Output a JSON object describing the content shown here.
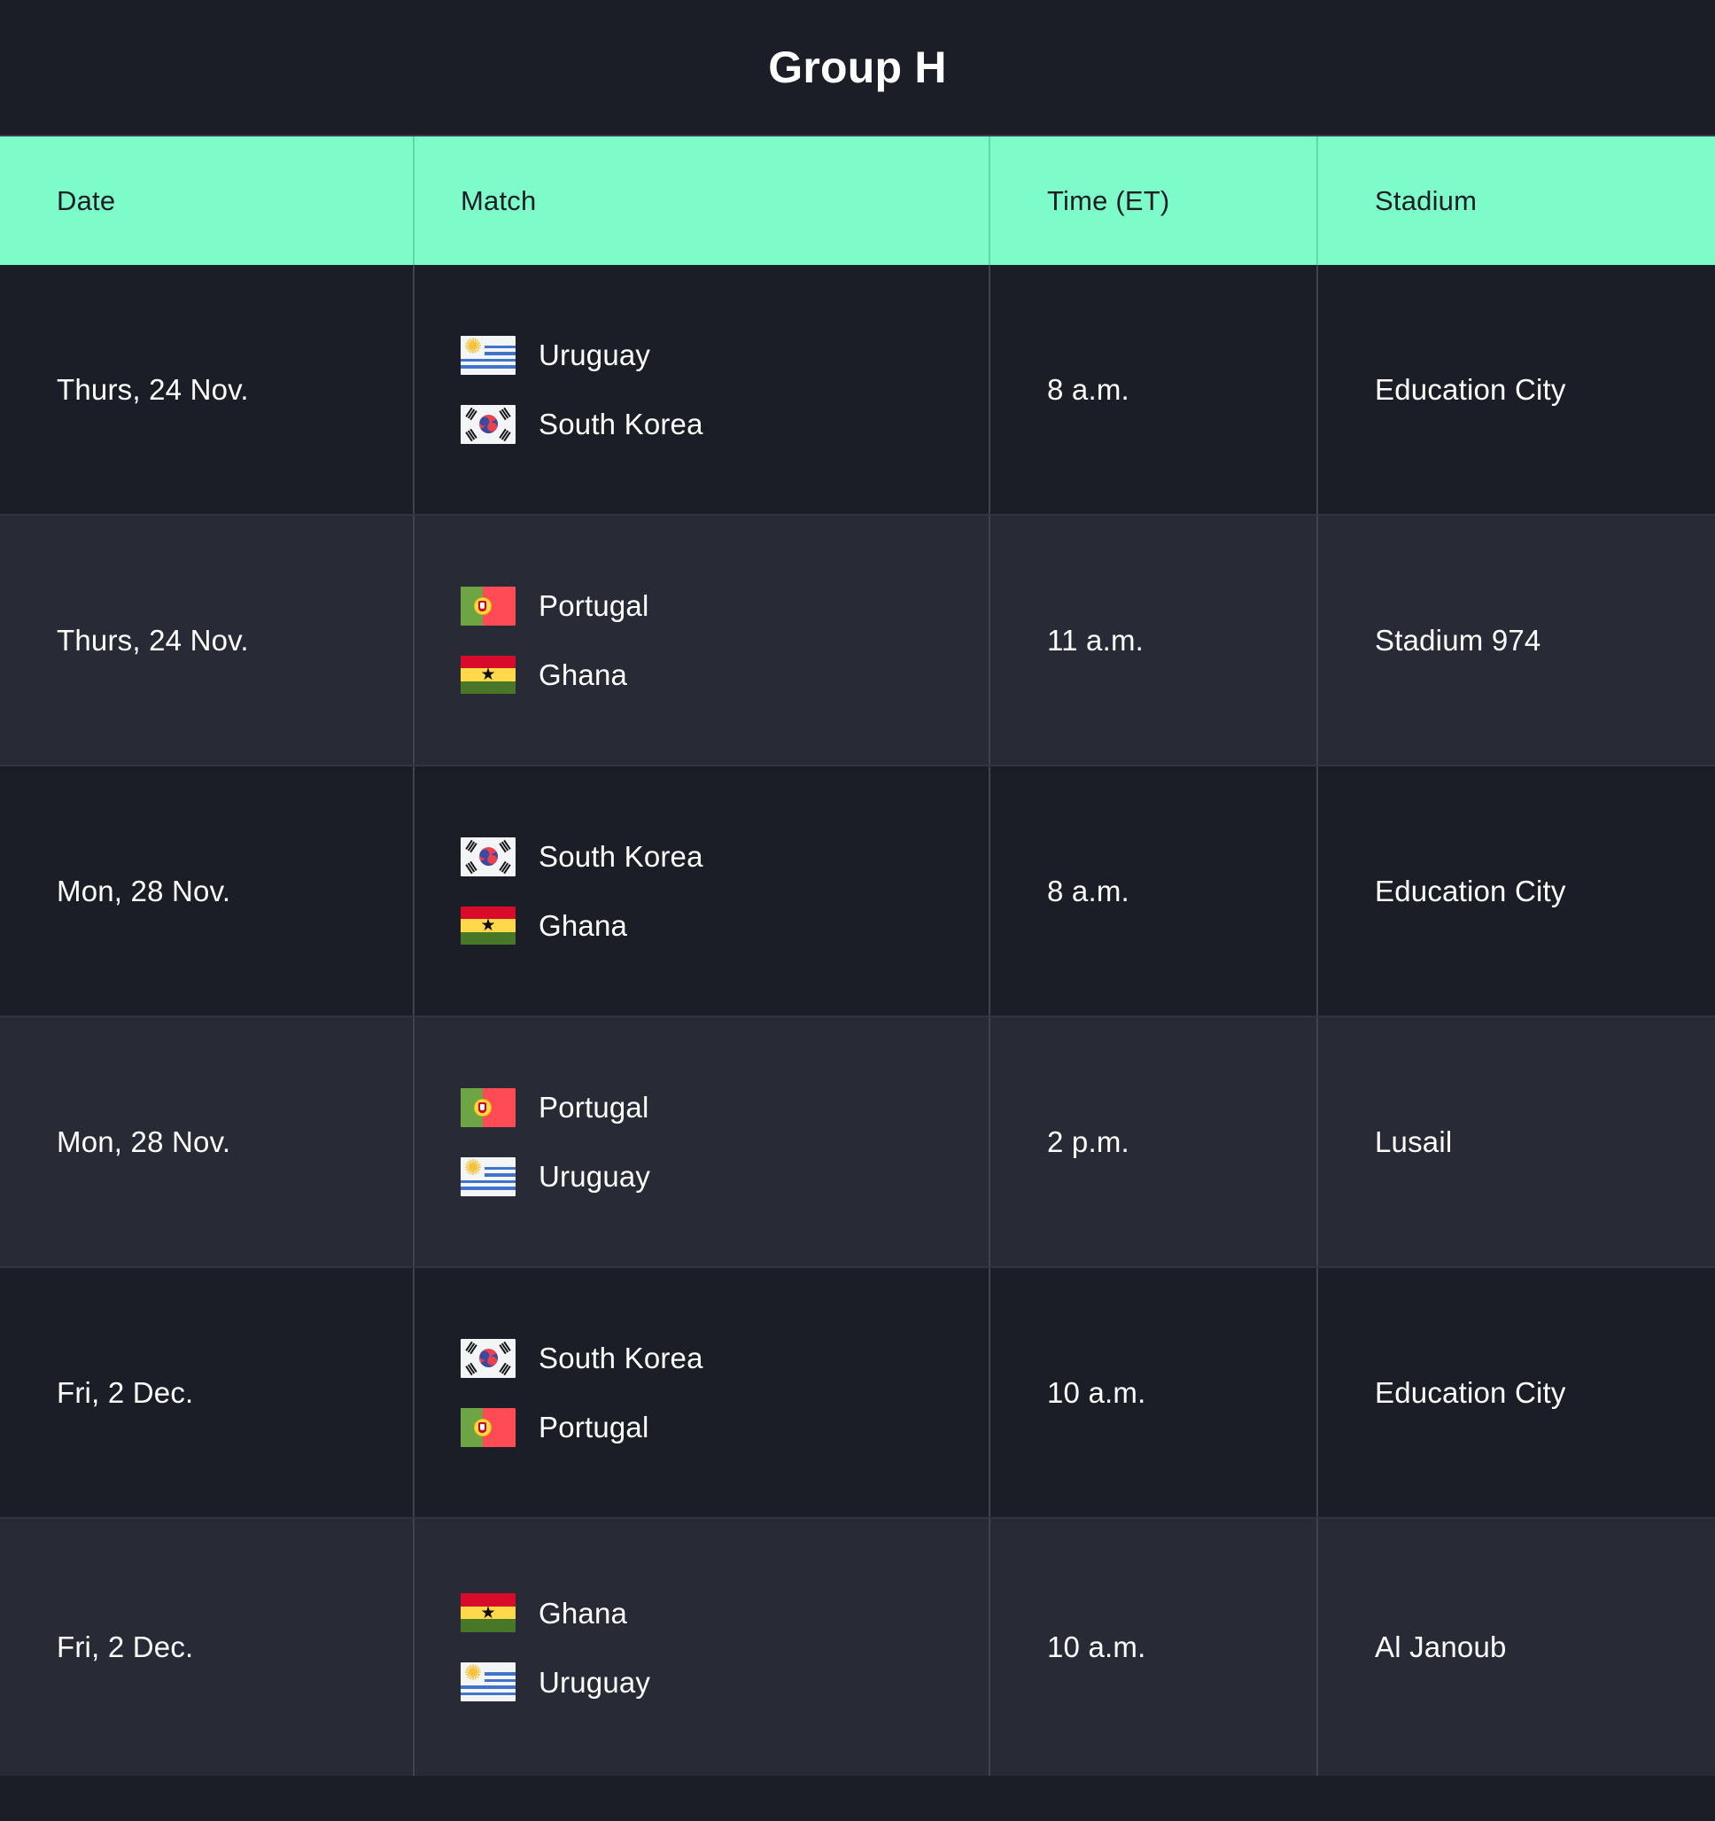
{
  "page": {
    "title": "Group H"
  },
  "colors": {
    "header_background": "#7dfbc8",
    "header_text": "#1c1e27",
    "row_odd_background": "#1c1e27",
    "row_even_background": "#282a36",
    "body_text": "#ffffff",
    "divider": "#40434f"
  },
  "table": {
    "columns": [
      {
        "key": "date",
        "label": "Date"
      },
      {
        "key": "match",
        "label": "Match"
      },
      {
        "key": "time",
        "label": "Time (ET)"
      },
      {
        "key": "stadium",
        "label": "Stadium"
      }
    ],
    "rows": [
      {
        "date": "Thurs, 24 Nov.",
        "teams": [
          {
            "name": "Uruguay",
            "flag": "uruguay-flag-icon"
          },
          {
            "name": "South Korea",
            "flag": "south-korea-flag-icon"
          }
        ],
        "time": "8 a.m.",
        "stadium": "Education City"
      },
      {
        "date": "Thurs, 24 Nov.",
        "teams": [
          {
            "name": "Portugal",
            "flag": "portugal-flag-icon"
          },
          {
            "name": "Ghana",
            "flag": "ghana-flag-icon"
          }
        ],
        "time": "11 a.m.",
        "stadium": "Stadium 974"
      },
      {
        "date": "Mon, 28 Nov.",
        "teams": [
          {
            "name": "South Korea",
            "flag": "south-korea-flag-icon"
          },
          {
            "name": "Ghana",
            "flag": "ghana-flag-icon"
          }
        ],
        "time": "8 a.m.",
        "stadium": "Education City"
      },
      {
        "date": "Mon, 28 Nov.",
        "teams": [
          {
            "name": "Portugal",
            "flag": "portugal-flag-icon"
          },
          {
            "name": "Uruguay",
            "flag": "uruguay-flag-icon"
          }
        ],
        "time": "2 p.m.",
        "stadium": "Lusail"
      },
      {
        "date": "Fri, 2 Dec.",
        "teams": [
          {
            "name": "South Korea",
            "flag": "south-korea-flag-icon"
          },
          {
            "name": "Portugal",
            "flag": "portugal-flag-icon"
          }
        ],
        "time": "10 a.m.",
        "stadium": "Education City"
      },
      {
        "date": "Fri, 2 Dec.",
        "teams": [
          {
            "name": "Ghana",
            "flag": "ghana-flag-icon"
          },
          {
            "name": "Uruguay",
            "flag": "uruguay-flag-icon"
          }
        ],
        "time": "10 a.m.",
        "stadium": "Al Janoub"
      }
    ]
  }
}
